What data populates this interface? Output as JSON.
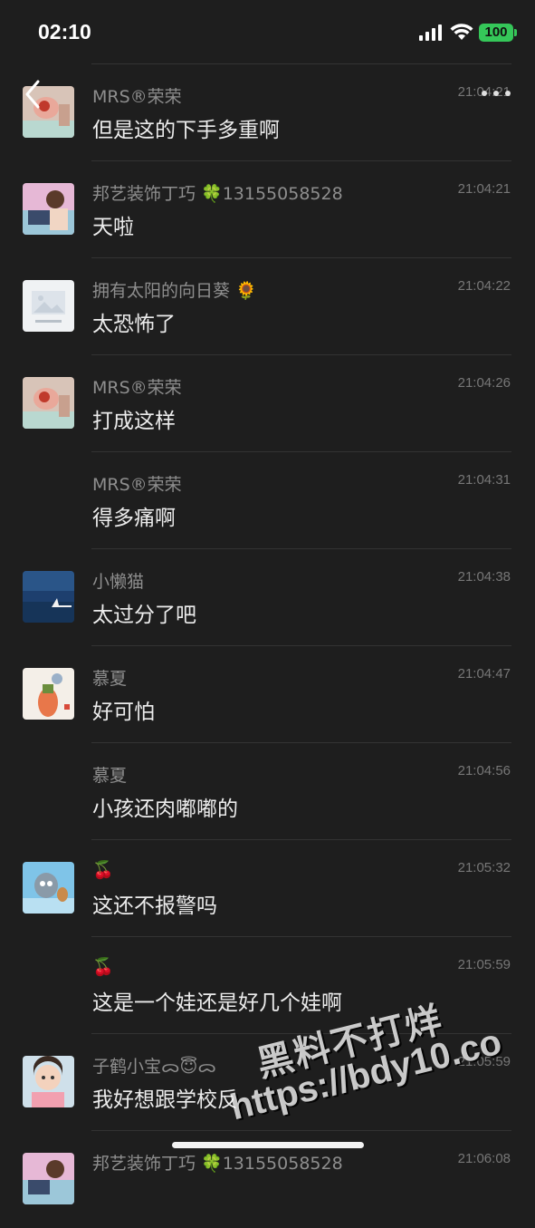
{
  "status_bar": {
    "time": "02:10",
    "battery": "100"
  },
  "comments": [
    {
      "name": "MRS®荣荣",
      "time": "21:04:21",
      "text": "但是这的下手多重啊",
      "avatar": "avatar-mrs"
    },
    {
      "name": "邦艺装饰丁巧 🍀13155058528",
      "time": "21:04:21",
      "text": "天啦",
      "avatar": "avatar-bangyi"
    },
    {
      "name": "拥有太阳的向日葵 🌻",
      "time": "21:04:22",
      "text": "太恐怖了",
      "avatar": "avatar-sunflower"
    },
    {
      "name": "MRS®荣荣",
      "time": "21:04:26",
      "text": "打成这样",
      "avatar": "avatar-mrs"
    },
    {
      "name": "MRS®荣荣",
      "time": "21:04:31",
      "text": "得多痛啊",
      "avatar": ""
    },
    {
      "name": "小懒猫",
      "time": "21:04:38",
      "text": "太过分了吧",
      "avatar": "avatar-sea"
    },
    {
      "name": "慕夏",
      "time": "21:04:47",
      "text": "好可怕",
      "avatar": "avatar-muxia"
    },
    {
      "name": "慕夏",
      "time": "21:04:56",
      "text": "小孩还肉嘟嘟的",
      "avatar": ""
    },
    {
      "name": "🍒",
      "time": "21:05:32",
      "text": "这还不报警吗",
      "avatar": "avatar-tomjerry"
    },
    {
      "name": "🍒",
      "time": "21:05:59",
      "text": "这是一个娃还是好几个娃啊",
      "avatar": ""
    },
    {
      "name": "子鹤小宝ᯅ😇ᯅ",
      "time": "21:05:59",
      "text": "我好想跟学校反",
      "avatar": "avatar-child"
    },
    {
      "name": "邦艺装饰丁巧 🍀13155058528",
      "time": "21:06:08",
      "text": "",
      "avatar": "avatar-bangyi"
    }
  ],
  "watermark": {
    "line1": "黑料不打烊",
    "line2": "https://bdy10.co"
  }
}
